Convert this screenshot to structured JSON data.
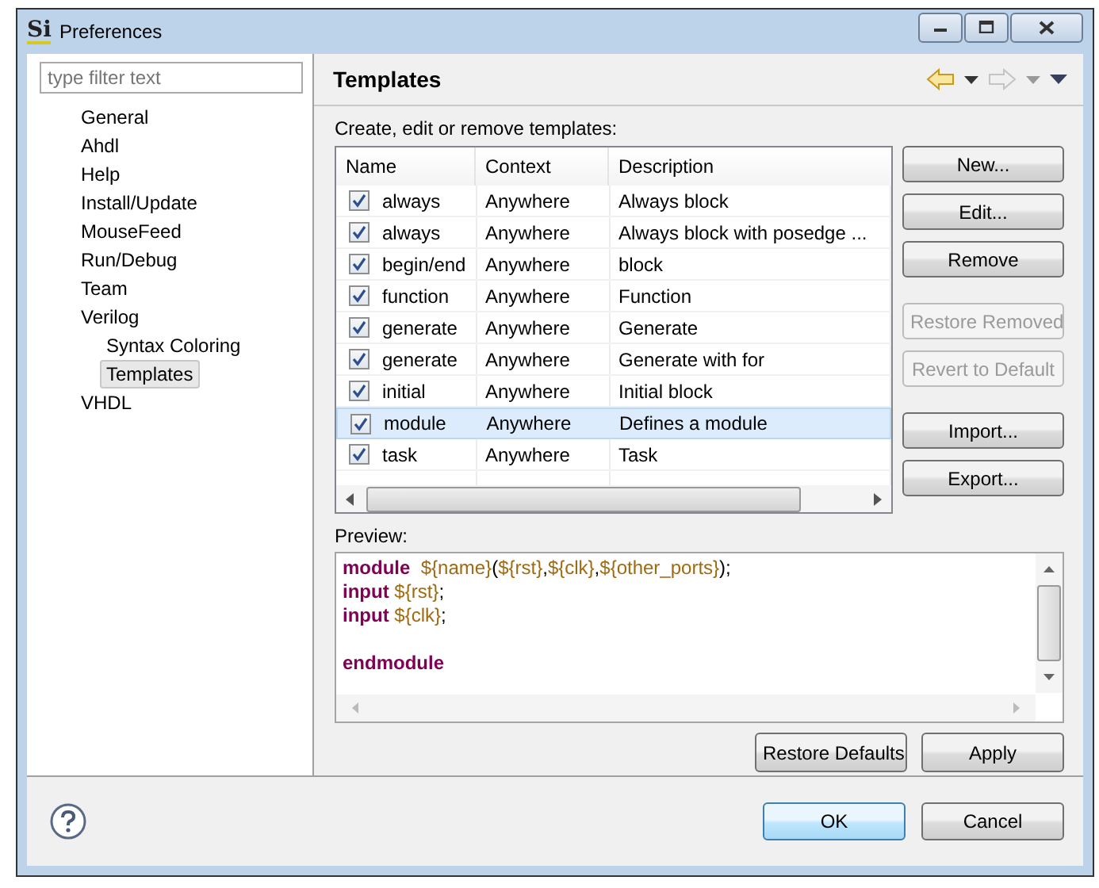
{
  "window": {
    "title": "Preferences",
    "icon": "Si"
  },
  "filter": {
    "placeholder": "type filter text"
  },
  "tree": [
    {
      "label": "General",
      "selected": false
    },
    {
      "label": "Ahdl",
      "selected": false
    },
    {
      "label": "Help",
      "selected": false
    },
    {
      "label": "Install/Update",
      "selected": false
    },
    {
      "label": "MouseFeed",
      "selected": false
    },
    {
      "label": "Run/Debug",
      "selected": false
    },
    {
      "label": "Team",
      "selected": false
    },
    {
      "label": "Verilog",
      "selected": false,
      "children": [
        {
          "label": "Syntax Coloring",
          "selected": false
        },
        {
          "label": "Templates",
          "selected": true
        }
      ]
    },
    {
      "label": "VHDL",
      "selected": false
    }
  ],
  "page": {
    "title": "Templates",
    "description": "Create, edit or remove templates:"
  },
  "table": {
    "columns": [
      "Name",
      "Context",
      "Description"
    ],
    "rows": [
      {
        "name": "always",
        "context": "Anywhere",
        "description": "Always block",
        "checked": true,
        "selected": false
      },
      {
        "name": "always",
        "context": "Anywhere",
        "description": "Always block with posedge ...",
        "checked": true,
        "selected": false
      },
      {
        "name": "begin/end",
        "context": "Anywhere",
        "description": "block",
        "checked": true,
        "selected": false
      },
      {
        "name": "function",
        "context": "Anywhere",
        "description": "Function",
        "checked": true,
        "selected": false
      },
      {
        "name": "generate",
        "context": "Anywhere",
        "description": "Generate",
        "checked": true,
        "selected": false
      },
      {
        "name": "generate",
        "context": "Anywhere",
        "description": "Generate with for",
        "checked": true,
        "selected": false
      },
      {
        "name": "initial",
        "context": "Anywhere",
        "description": "Initial block",
        "checked": true,
        "selected": false
      },
      {
        "name": "module",
        "context": "Anywhere",
        "description": "Defines a module",
        "checked": true,
        "selected": true
      },
      {
        "name": "task",
        "context": "Anywhere",
        "description": "Task",
        "checked": true,
        "selected": false
      }
    ]
  },
  "side_button_groups": [
    [
      {
        "label": "New...",
        "disabled": false
      },
      {
        "label": "Edit...",
        "disabled": false
      },
      {
        "label": "Remove",
        "disabled": false
      }
    ],
    [
      {
        "label": "Restore Removed",
        "disabled": true
      },
      {
        "label": "Revert to Default",
        "disabled": true
      }
    ],
    [
      {
        "label": "Import...",
        "disabled": false
      },
      {
        "label": "Export...",
        "disabled": false
      }
    ]
  ],
  "preview": {
    "label": "Preview:",
    "blocks": [
      [
        [
          {
            "text": "module  ",
            "kind": "keyword"
          },
          {
            "text": "${name}",
            "kind": "variable"
          },
          {
            "text": "(",
            "kind": "plain"
          },
          {
            "text": "${rst}",
            "kind": "variable"
          },
          {
            "text": ",",
            "kind": "plain"
          },
          {
            "text": "${clk}",
            "kind": "variable"
          },
          {
            "text": ",",
            "kind": "plain"
          },
          {
            "text": "${other_ports}",
            "kind": "variable"
          },
          {
            "text": ");",
            "kind": "plain"
          }
        ],
        [
          {
            "text": "input ",
            "kind": "keyword"
          },
          {
            "text": "${rst}",
            "kind": "variable"
          },
          {
            "text": ";",
            "kind": "plain"
          }
        ],
        [
          {
            "text": "input ",
            "kind": "keyword"
          },
          {
            "text": "${clk}",
            "kind": "variable"
          },
          {
            "text": ";",
            "kind": "plain"
          }
        ]
      ],
      [
        [
          {
            "text": "endmodule",
            "kind": "keyword"
          }
        ]
      ]
    ]
  },
  "page_buttons": [
    {
      "label": "Restore Defaults",
      "default": false
    },
    {
      "label": "Apply",
      "default": false
    }
  ],
  "footer_buttons": [
    {
      "label": "OK",
      "default": true
    },
    {
      "label": "Cancel",
      "default": false
    }
  ]
}
